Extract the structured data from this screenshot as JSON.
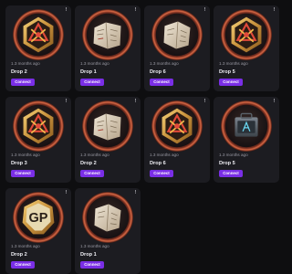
{
  "colors": {
    "background": "#0e0e10",
    "card": "#1c1c21",
    "accent": "#7a2ee6",
    "ring": "#c0583a"
  },
  "cards": [
    {
      "time": "1.3 months ago",
      "title": "Drop 2",
      "button": "Connect",
      "info_icon": "!",
      "art": "emblem-icon"
    },
    {
      "time": "1.3 months ago",
      "title": "Drop 1",
      "button": "Connect",
      "info_icon": "!",
      "art": "map-icon"
    },
    {
      "time": "1.3 months ago",
      "title": "Drop 6",
      "button": "Connect",
      "info_icon": "!",
      "art": "map-icon"
    },
    {
      "time": "1.3 months ago",
      "title": "Drop 5",
      "button": "Connect",
      "info_icon": "!",
      "art": "emblem-icon"
    },
    {
      "time": "1.3 months ago",
      "title": "Drop 3",
      "button": "Connect",
      "info_icon": "!",
      "art": "emblem-icon"
    },
    {
      "time": "1.3 months ago",
      "title": "Drop 2",
      "button": "Connect",
      "info_icon": "!",
      "art": "map-icon"
    },
    {
      "time": "1.3 months ago",
      "title": "Drop 6",
      "button": "Connect",
      "info_icon": "!",
      "art": "emblem-icon"
    },
    {
      "time": "1.3 months ago",
      "title": "Drop 5",
      "button": "Connect",
      "info_icon": "!",
      "art": "case-icon"
    },
    {
      "time": "1.3 months ago",
      "title": "Drop 2",
      "button": "Connect",
      "info_icon": "!",
      "art": "gp-coin-icon",
      "art_text": "GP"
    },
    {
      "time": "1.3 months ago",
      "title": "Drop 1",
      "button": "Connect",
      "info_icon": "!",
      "art": "map-icon"
    }
  ]
}
